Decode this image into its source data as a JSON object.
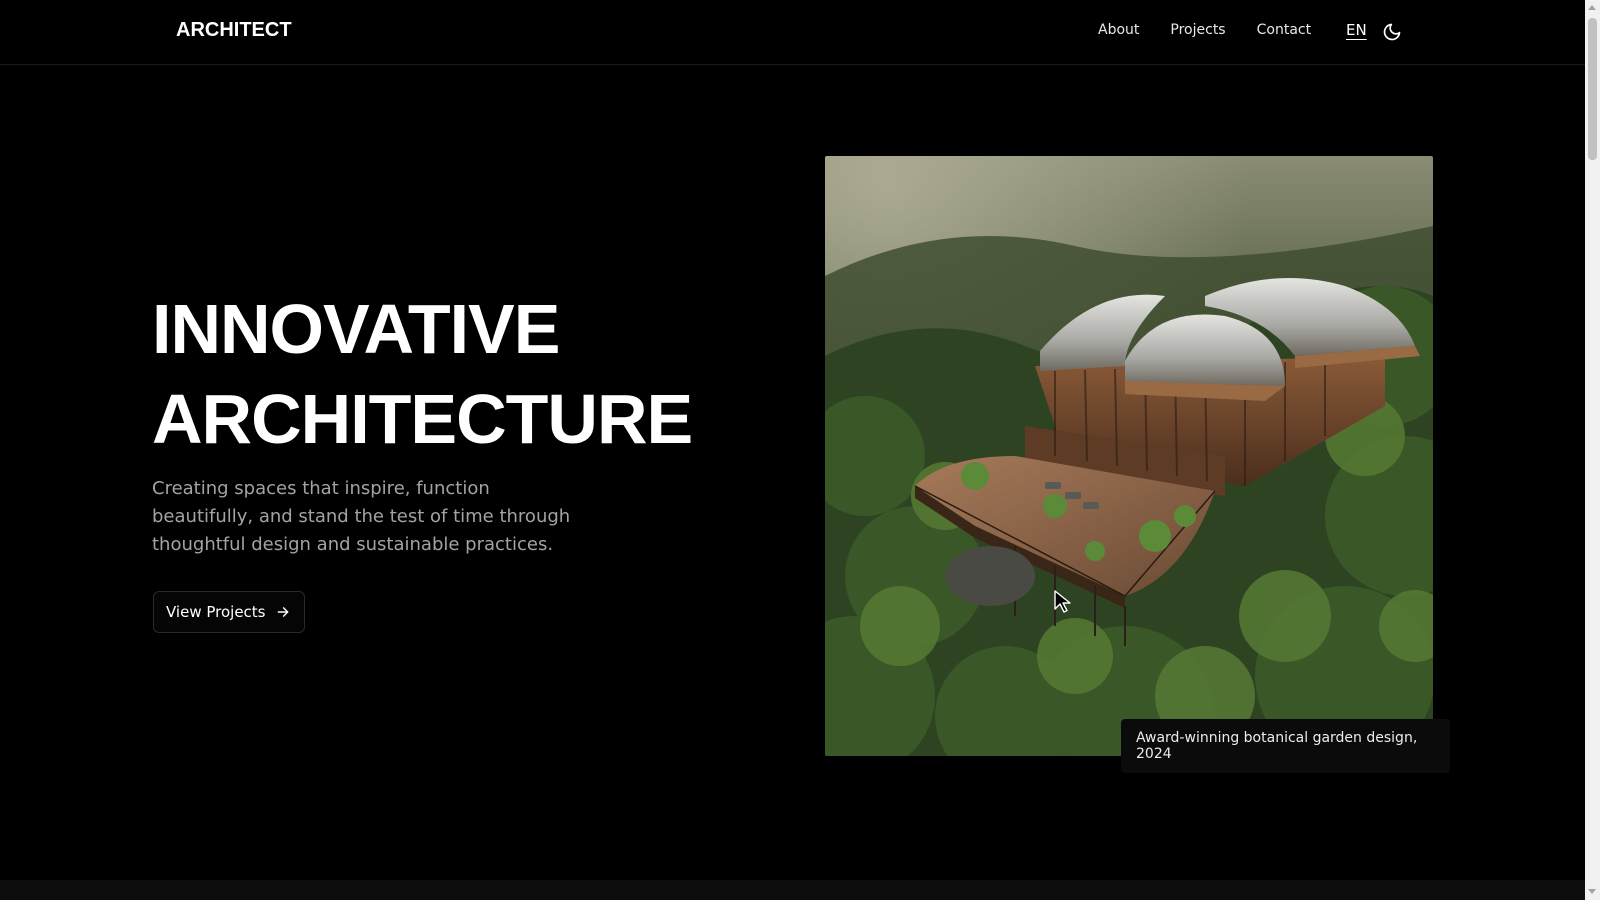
{
  "header": {
    "brand": "ARCHITECT",
    "nav": [
      {
        "label": "About"
      },
      {
        "label": "Projects"
      },
      {
        "label": "Contact"
      }
    ],
    "language": "EN",
    "theme_icon": "moon-icon"
  },
  "hero": {
    "title_line1": "INNOVATIVE",
    "title_line2": "ARCHITECTURE",
    "subtitle": "Creating spaces that inspire, function beautifully, and stand the test of time through thoughtful design and sustainable practices.",
    "cta_label": "View Projects",
    "cta_icon": "arrow-right-icon",
    "image_caption": "Award-winning botanical garden design, 2024"
  },
  "colors": {
    "background": "#000000",
    "text": "#ffffff",
    "muted_text": "#a3a3a3",
    "border": "#2a2a2a"
  }
}
